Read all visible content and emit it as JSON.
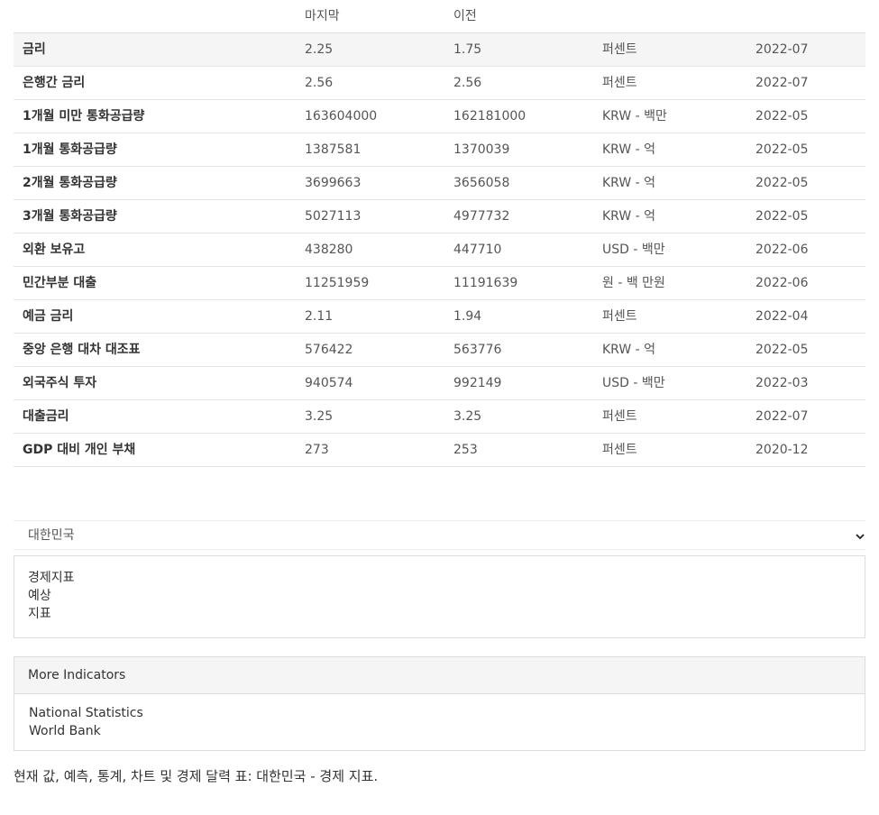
{
  "table": {
    "headers": [
      "마지막",
      "이전"
    ],
    "rows": [
      {
        "name": "금리",
        "last": "2.25",
        "prev": "1.75",
        "unit": "퍼센트",
        "date": "2022-07"
      },
      {
        "name": "은행간 금리",
        "last": "2.56",
        "prev": "2.56",
        "unit": "퍼센트",
        "date": "2022-07"
      },
      {
        "name": "1개월 미만 통화공급량",
        "last": "163604000",
        "prev": "162181000",
        "unit": "KRW - 백만",
        "date": "2022-05"
      },
      {
        "name": "1개월 통화공급량",
        "last": "1387581",
        "prev": "1370039",
        "unit": "KRW - 억",
        "date": "2022-05"
      },
      {
        "name": "2개월 통화공급량",
        "last": "3699663",
        "prev": "3656058",
        "unit": "KRW - 억",
        "date": "2022-05"
      },
      {
        "name": "3개월 통화공급량",
        "last": "5027113",
        "prev": "4977732",
        "unit": "KRW - 억",
        "date": "2022-05"
      },
      {
        "name": "외환 보유고",
        "last": "438280",
        "prev": "447710",
        "unit": "USD - 백만",
        "date": "2022-06"
      },
      {
        "name": "민간부분 대출",
        "last": "11251959",
        "prev": "11191639",
        "unit": "원 - 백 만원",
        "date": "2022-06"
      },
      {
        "name": "예금 금리",
        "last": "2.11",
        "prev": "1.94",
        "unit": "퍼센트",
        "date": "2022-04"
      },
      {
        "name": "중앙 은행 대차 대조표",
        "last": "576422",
        "prev": "563776",
        "unit": "KRW - 억",
        "date": "2022-05"
      },
      {
        "name": "외국주식 투자",
        "last": "940574",
        "prev": "992149",
        "unit": "USD - 백만",
        "date": "2022-03"
      },
      {
        "name": "대출금리",
        "last": "3.25",
        "prev": "3.25",
        "unit": "퍼센트",
        "date": "2022-07"
      },
      {
        "name": "GDP 대비 개인 부채",
        "last": "273",
        "prev": "253",
        "unit": "퍼센트",
        "date": "2020-12"
      }
    ]
  },
  "country_select": {
    "value": "대한민국",
    "icon": "chevron-down-icon"
  },
  "links": [
    "경제지표",
    "예상",
    "지표"
  ],
  "more_indicators": {
    "title": "More Indicators",
    "links": [
      "National Statistics",
      "World Bank"
    ]
  },
  "footer": "현재 값, 예측, 통계, 차트 및 경제 달력 표: 대한민국 - 경제 지표."
}
